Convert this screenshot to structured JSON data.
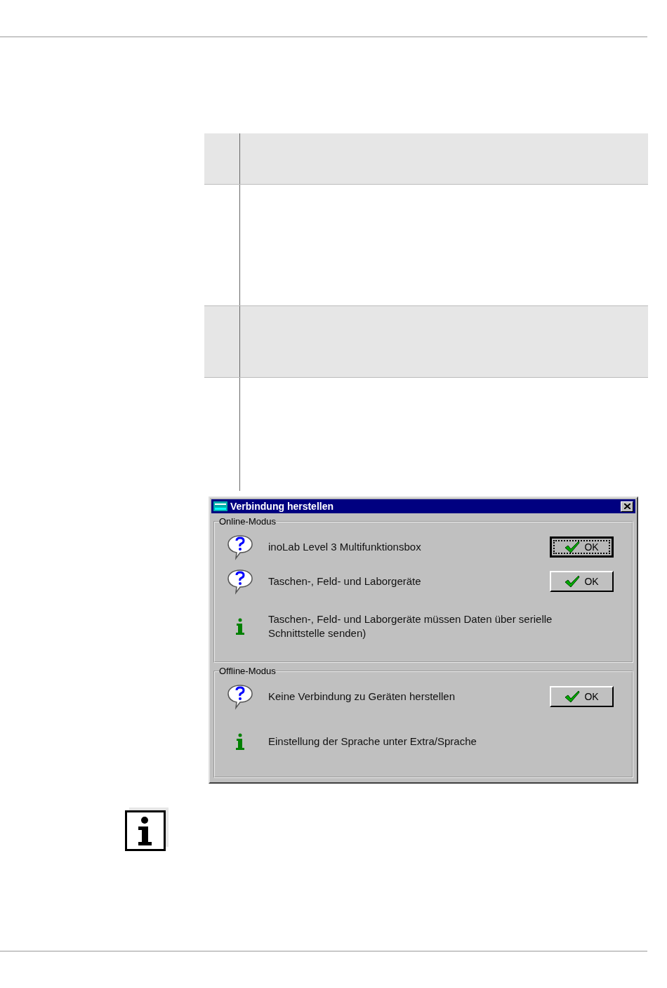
{
  "dialog": {
    "title": "Verbindung herstellen",
    "groups": [
      {
        "label": "Online-Modus",
        "items": [
          {
            "kind": "question",
            "text": "inoLab Level 3 Multifunktionsbox",
            "button": {
              "label": "OK",
              "focused": true
            }
          },
          {
            "kind": "question",
            "text": "Taschen-, Feld- und Laborgeräte",
            "button": {
              "label": "OK",
              "focused": false
            }
          },
          {
            "kind": "info",
            "text": "Taschen-, Feld- und Laborgeräte  müssen Daten über serielle Schnittstelle senden)"
          }
        ]
      },
      {
        "label": "Offline-Modus",
        "items": [
          {
            "kind": "question",
            "text": "Keine Verbindung zu Geräten herstellen",
            "button": {
              "label": "OK",
              "focused": false
            }
          },
          {
            "kind": "info",
            "text": "Einstellung der Sprache unter Extra/Sprache"
          }
        ]
      }
    ]
  }
}
